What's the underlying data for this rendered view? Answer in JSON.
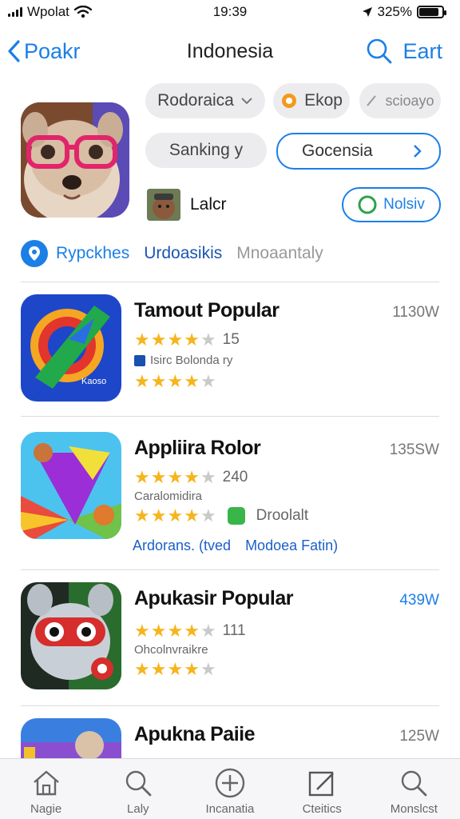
{
  "status": {
    "carrier": "Wpolat",
    "time": "19:39",
    "battery": "325%",
    "battery_level": 0.85
  },
  "nav": {
    "back_label": "Poakr",
    "title": "Indonesia",
    "right_label": "Eart"
  },
  "header": {
    "pills": [
      {
        "label": "Rodoraica"
      },
      {
        "label": "Ekop"
      },
      {
        "label": "scioayo"
      },
      {
        "label": "Sanking y"
      },
      {
        "label": "Gocensia"
      },
      {
        "label": "Nolsiv"
      }
    ],
    "developer": {
      "label": "Lalcr"
    }
  },
  "tabs": [
    {
      "label": "Rypckhes"
    },
    {
      "label": "Urdoasikis"
    },
    {
      "label": "Mnoaantaly"
    }
  ],
  "apps": [
    {
      "title": "Tamout Popular",
      "size": "1130W",
      "rating_count": "15",
      "subtitle": "Isirc Bolonda ry",
      "stars_primary": 4,
      "stars_secondary": 4,
      "icon_text": "Kaoso"
    },
    {
      "title": "Appliira Rolor",
      "size": "135SW",
      "rating_count": "240",
      "subtitle": "Caralomidira",
      "stars_primary": 4,
      "stars_secondary": 4,
      "developer": "Droolalt",
      "links": [
        "Ardorans. (tved",
        "Modoea Fatin)"
      ]
    },
    {
      "title": "Apukasir Popular",
      "size": "439W",
      "rating_count": "111",
      "subtitle": "Ohcolnvraikre",
      "stars_primary": 4,
      "stars_secondary": 4
    },
    {
      "title": "Apuknа Paiie",
      "size": "125W"
    }
  ],
  "tab_bar": [
    {
      "label": "Nagie",
      "icon": "home-icon"
    },
    {
      "label": "Laly",
      "icon": "search-icon"
    },
    {
      "label": "Incanatia",
      "icon": "plus-circle-icon"
    },
    {
      "label": "Cteitics",
      "icon": "edit-icon"
    },
    {
      "label": "Monslcst",
      "icon": "search-icon"
    }
  ],
  "colors": {
    "accent": "#1b7fe6",
    "star": "#f6b51c",
    "star_empty": "#c9c9c9"
  }
}
